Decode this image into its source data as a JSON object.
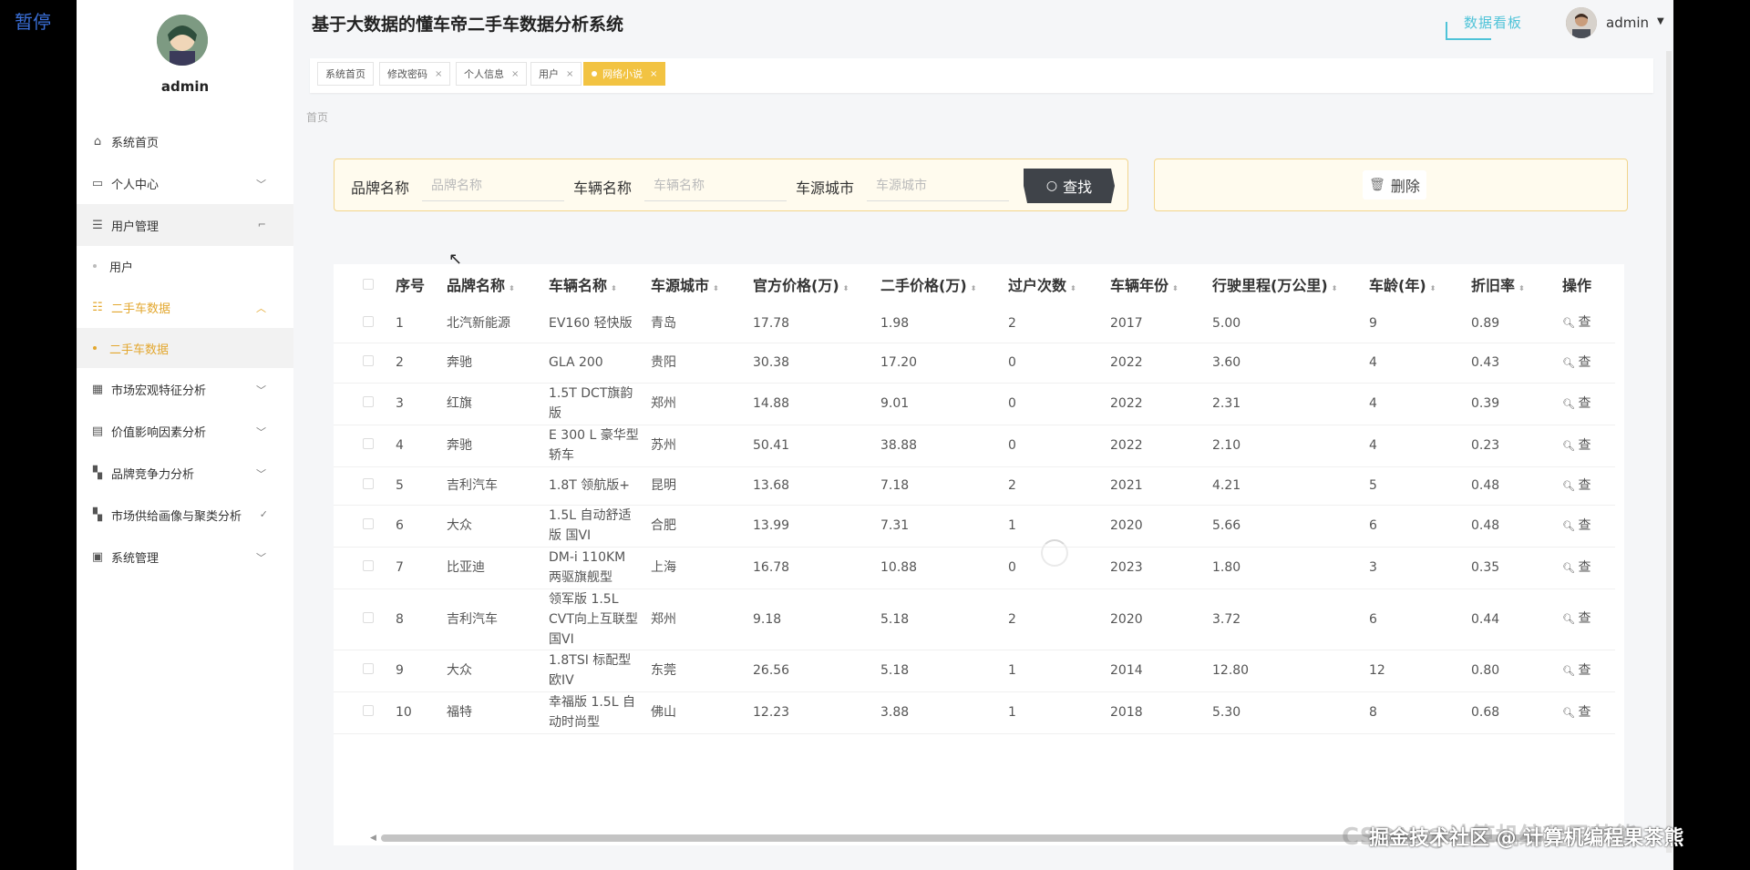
{
  "overlay": {
    "pause_label": "暂停"
  },
  "header": {
    "title": "基于大数据的懂车帝二手车数据分析系统",
    "dashboard_link": "数据看板",
    "user": "admin"
  },
  "sidebar": {
    "user": "admin",
    "items": [
      {
        "label": "系统首页",
        "icon": "home-icon"
      },
      {
        "label": "个人中心",
        "icon": "profile-icon",
        "expandable": true
      },
      {
        "label": "用户管理",
        "icon": "list-icon",
        "expandable": true,
        "expanded": true
      },
      {
        "label": "用户",
        "sub": true
      },
      {
        "label": "二手车数据",
        "icon": "sliders-icon",
        "expandable": true,
        "expanded": true
      },
      {
        "label": "二手车数据",
        "sub": true,
        "active": true
      },
      {
        "label": "市场宏观特征分析",
        "icon": "grid-icon",
        "expandable": true
      },
      {
        "label": "价值影响因素分析",
        "icon": "clipboard-icon",
        "expandable": true
      },
      {
        "label": "品牌竞争力分析",
        "icon": "tiles-icon",
        "expandable": true
      },
      {
        "label": "市场供给画像与聚类分析",
        "icon": "tiles-icon",
        "expandable": true
      },
      {
        "label": "系统管理",
        "icon": "clipboard-check-icon",
        "expandable": true
      }
    ]
  },
  "tabs": [
    {
      "label": "系统首页",
      "closable": false
    },
    {
      "label": "修改密码",
      "closable": true,
      "close": "×"
    },
    {
      "label": "个人信息",
      "closable": true,
      "close": "×"
    },
    {
      "label": "用户",
      "closable": true,
      "close": "×"
    },
    {
      "label": "网络小说",
      "closable": true,
      "close": "×",
      "active": true
    }
  ],
  "breadcrumb": "首页",
  "search": {
    "brand_label": "品牌名称",
    "brand_placeholder": "品牌名称",
    "vehicle_label": "车辆名称",
    "vehicle_placeholder": "车辆名称",
    "city_label": "车源城市",
    "city_placeholder": "车源城市",
    "search_button": "查找"
  },
  "actions": {
    "delete_button": "删除"
  },
  "table": {
    "columns": [
      "序号",
      "品牌名称",
      "车辆名称",
      "车源城市",
      "官方价格(万)",
      "二手价格(万)",
      "过户次数",
      "车辆年份",
      "行驶里程(万公里)",
      "车龄(年)",
      "折旧率",
      "操作"
    ],
    "op_label": "查",
    "rows": [
      [
        "1",
        "北汽新能源",
        "EV160 轻快版",
        "青岛",
        "17.78",
        "1.98",
        "2",
        "2017",
        "5.00",
        "9",
        "0.89"
      ],
      [
        "2",
        "奔驰",
        "GLA 200",
        "贵阳",
        "30.38",
        "17.20",
        "0",
        "2022",
        "3.60",
        "4",
        "0.43"
      ],
      [
        "3",
        "红旗",
        "1.5T DCT旗韵版",
        "郑州",
        "14.88",
        "9.01",
        "0",
        "2022",
        "2.31",
        "4",
        "0.39"
      ],
      [
        "4",
        "奔驰",
        "E 300 L 豪华型 轿车",
        "苏州",
        "50.41",
        "38.88",
        "0",
        "2022",
        "2.10",
        "4",
        "0.23"
      ],
      [
        "5",
        "吉利汽车",
        "1.8T 领航版+",
        "昆明",
        "13.68",
        "7.18",
        "2",
        "2021",
        "4.21",
        "5",
        "0.48"
      ],
      [
        "6",
        "大众",
        "1.5L 自动舒适版 国VI",
        "合肥",
        "13.99",
        "7.31",
        "1",
        "2020",
        "5.66",
        "6",
        "0.48"
      ],
      [
        "7",
        "比亚迪",
        "DM-i 110KM 两驱旗舰型",
        "上海",
        "16.78",
        "10.88",
        "0",
        "2023",
        "1.80",
        "3",
        "0.35"
      ],
      [
        "8",
        "吉利汽车",
        "领军版 1.5L CVT向上互联型 国VI",
        "郑州",
        "9.18",
        "5.18",
        "2",
        "2020",
        "3.72",
        "6",
        "0.44"
      ],
      [
        "9",
        "大众",
        "1.8TSI 标配型 欧IV",
        "东莞",
        "26.56",
        "5.18",
        "1",
        "2014",
        "12.80",
        "12",
        "0.80"
      ],
      [
        "10",
        "福特",
        "幸福版 1.5L 自动时尚型",
        "佛山",
        "12.23",
        "3.88",
        "1",
        "2018",
        "5.30",
        "8",
        "0.68"
      ]
    ]
  },
  "watermark": "掘金技术社区 @ 计算机编程果茶熊",
  "watermark_faint": "CSDN @计算机编程果茶熊",
  "colors": {
    "accent": "#f2c342",
    "active_menu": "#e3a72e",
    "dashboard_link": "#4fc3d8",
    "search_button": "#3f4349"
  }
}
